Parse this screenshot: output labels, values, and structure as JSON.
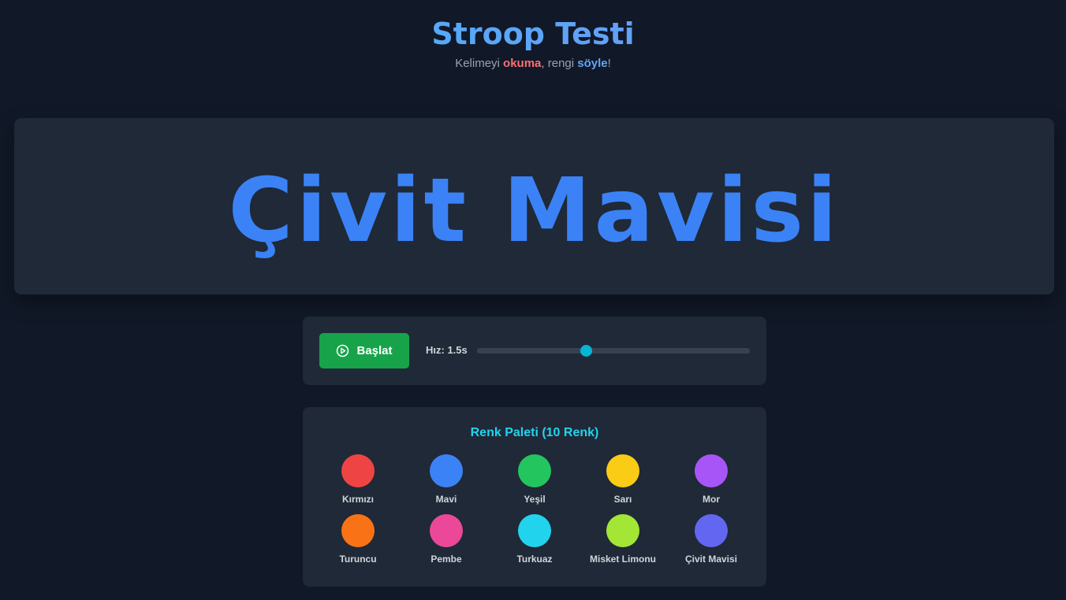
{
  "header": {
    "title": "Stroop Testi",
    "subtitle_part1": "Kelimeyi ",
    "subtitle_emph1": "okuma",
    "subtitle_part2": ", rengi ",
    "subtitle_emph2": "söyle",
    "subtitle_part3": "!"
  },
  "stimulus": {
    "word": "Çivit Mavisi",
    "ink_color": "#3b82f6"
  },
  "controls": {
    "start_label": "Başlat",
    "start_icon": "play-circle-icon",
    "start_color": "#16a34a",
    "speed_label": "Hız: 1.5s",
    "speed_fraction": 0.4,
    "accent_color": "#06b6d4"
  },
  "palette": {
    "title": "Renk Paleti (10 Renk)",
    "colors": [
      {
        "name": "Kırmızı",
        "hex": "#ef4444"
      },
      {
        "name": "Mavi",
        "hex": "#3b82f6"
      },
      {
        "name": "Yeşil",
        "hex": "#22c55e"
      },
      {
        "name": "Sarı",
        "hex": "#facc15"
      },
      {
        "name": "Mor",
        "hex": "#a855f7"
      },
      {
        "name": "Turuncu",
        "hex": "#f97316"
      },
      {
        "name": "Pembe",
        "hex": "#ec4899"
      },
      {
        "name": "Turkuaz",
        "hex": "#22d3ee"
      },
      {
        "name": "Misket Limonu",
        "hex": "#a3e635"
      },
      {
        "name": "Çivit Mavisi",
        "hex": "#6366f1"
      }
    ]
  }
}
